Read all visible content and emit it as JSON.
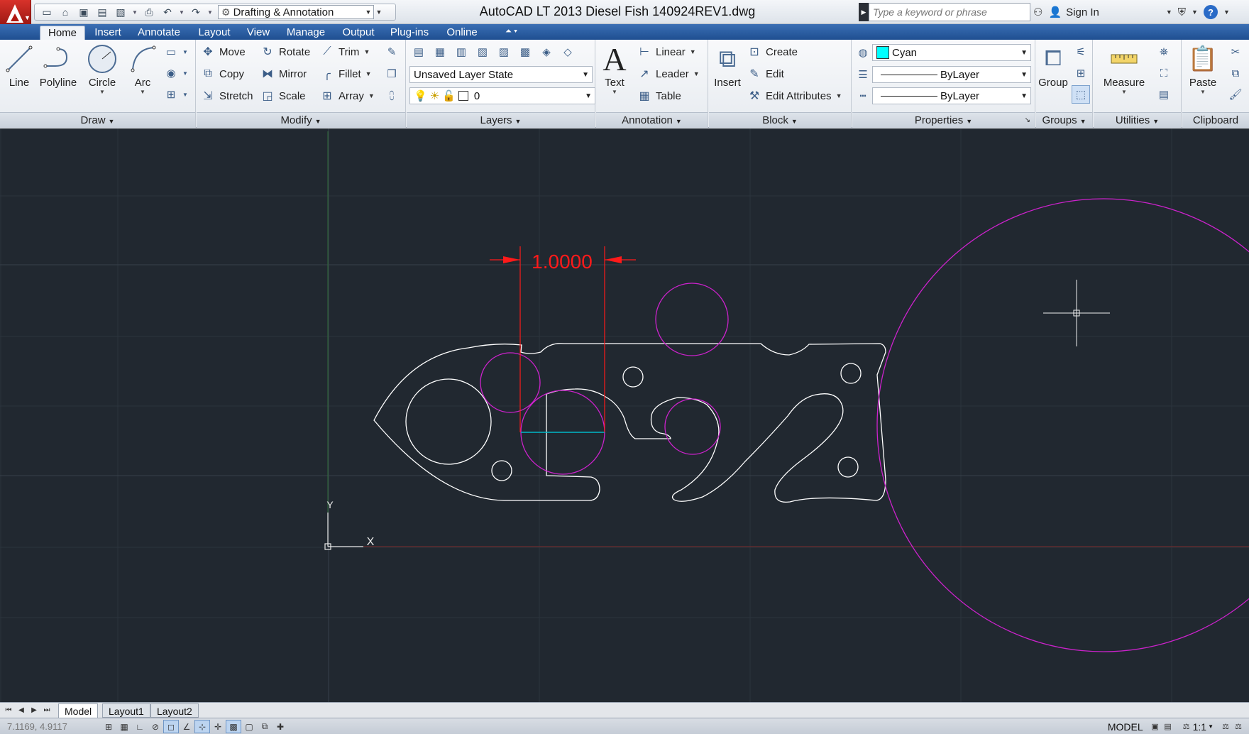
{
  "app": {
    "title": "AutoCAD LT 2013    Diesel Fish 140924REV1.dwg",
    "workspace": "Drafting & Annotation"
  },
  "search": {
    "placeholder": "Type a keyword or phrase"
  },
  "signin": {
    "label": "Sign In"
  },
  "help": {
    "glyph": "?"
  },
  "ribbon_tabs": [
    "Home",
    "Insert",
    "Annotate",
    "Layout",
    "View",
    "Manage",
    "Output",
    "Plug-ins",
    "Online"
  ],
  "panels": {
    "draw": {
      "title": "Draw",
      "buttons": [
        "Line",
        "Polyline",
        "Circle",
        "Arc"
      ]
    },
    "modify": {
      "title": "Modify",
      "items": [
        "Move",
        "Rotate",
        "Trim",
        "Copy",
        "Mirror",
        "Fillet",
        "Stretch",
        "Scale",
        "Array"
      ]
    },
    "layers": {
      "title": "Layers",
      "layer_state": "Unsaved Layer State",
      "current_layer": "0"
    },
    "annotation": {
      "title": "Annotation",
      "text_label": "Text",
      "items": [
        "Linear",
        "Leader",
        "Table"
      ]
    },
    "block": {
      "title": "Block",
      "insert_label": "Insert",
      "items": [
        "Create",
        "Edit",
        "Edit Attributes"
      ]
    },
    "properties": {
      "title": "Properties",
      "color": "Cyan",
      "linetype": "ByLayer",
      "lineweight": "ByLayer"
    },
    "groups": {
      "title": "Groups",
      "group_label": "Group"
    },
    "utilities": {
      "title": "Utilities",
      "measure_label": "Measure"
    },
    "clipboard": {
      "title": "Clipboard",
      "paste_label": "Paste"
    }
  },
  "drawing": {
    "dimension_text": "1.0000",
    "ucs_x": "X",
    "ucs_y": "Y"
  },
  "layout_tabs": [
    "Model",
    "Layout1",
    "Layout2"
  ],
  "status": {
    "coords": "7.1169, 4.9117",
    "space": "MODEL",
    "annotation_scale": "1:1"
  },
  "colors": {
    "canvas": "#212830",
    "geometry": "#ffffff",
    "magenta": "#cc22cc",
    "dimension": "#ff1a1a",
    "selection": "#00b8c8",
    "ribbon_tab_bar": "#2a5ea3"
  }
}
